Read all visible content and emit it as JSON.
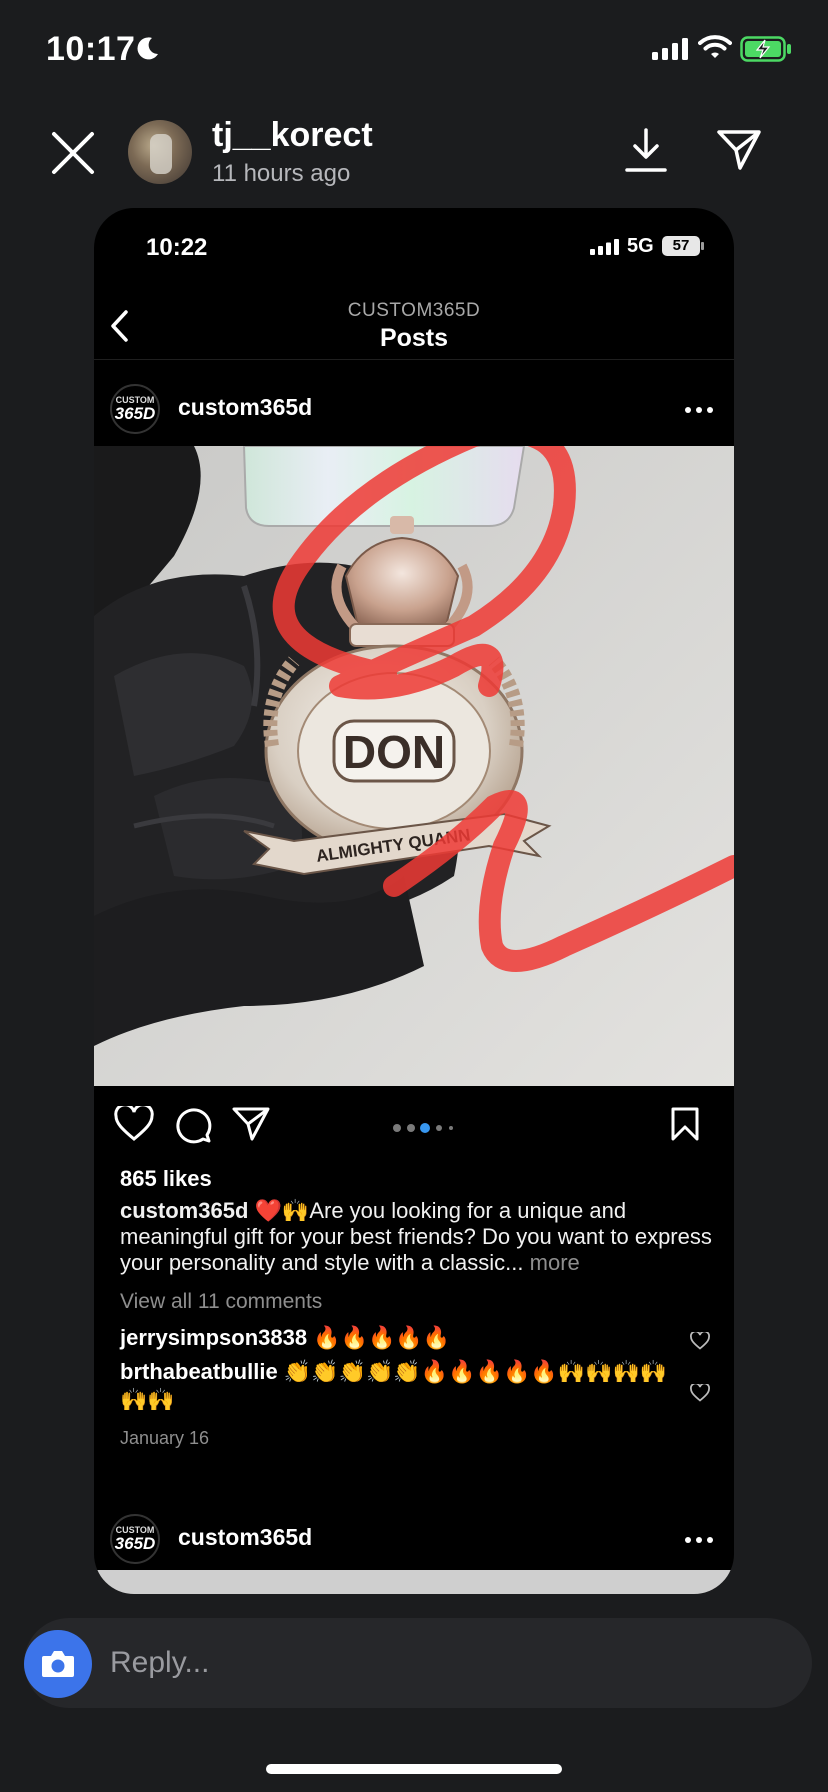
{
  "status_bar": {
    "time": "10:17",
    "battery_color": "#4cd964"
  },
  "story": {
    "username": "tj__korect",
    "time_ago": "11 hours ago",
    "icons": [
      "close-icon",
      "download-icon",
      "share-icon"
    ]
  },
  "screenshot": {
    "status": {
      "time": "10:22",
      "network": "5G",
      "battery": "57"
    },
    "nav": {
      "subtitle": "CUSTOM365D",
      "title": "Posts"
    },
    "post": {
      "logo_line1": "CUSTOM",
      "logo_line2": "365D",
      "username": "custom365d",
      "likes": "865 likes",
      "caption_user": "custom365d",
      "caption_emojis": "❤️🙌",
      "caption_text": "Are you looking for a unique and meaningful gift for your best friends? Do you want to express your personality and style with a classic...",
      "caption_more": "more",
      "view_comments": "View all 11 comments",
      "comments": [
        {
          "user": "jerrysimpson3838",
          "text": "🔥🔥🔥🔥🔥"
        },
        {
          "user": "brthabeatbullie",
          "text": "👏👏👏👏👏🔥🔥🔥🔥🔥🙌🙌🙌🙌🙌🙌"
        }
      ],
      "date": "January 16",
      "carousel_dots": 5,
      "carousel_active": 3,
      "pendant_text_top": "DON",
      "pendant_ribbon": "ALMIGHTY QUANN",
      "annotation_color": "#ef3a35"
    },
    "next_post": {
      "logo_line1": "CUSTOM",
      "logo_line2": "365D",
      "username": "custom365d"
    }
  },
  "reply": {
    "placeholder": "Reply..."
  },
  "accent_color": "#3c74ea"
}
